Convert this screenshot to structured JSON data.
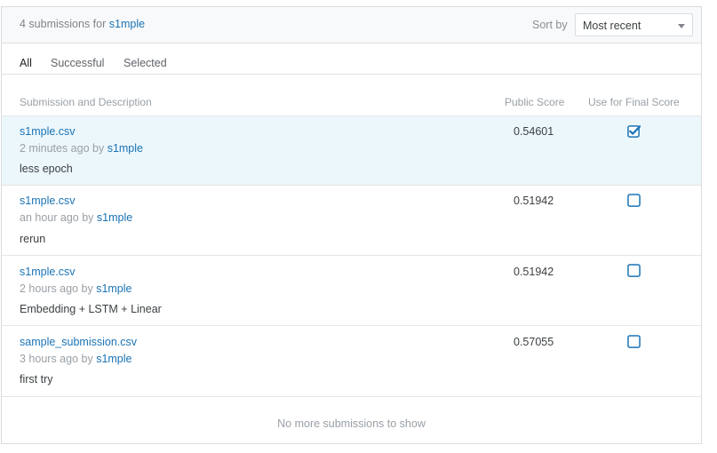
{
  "header": {
    "title_prefix": "4 submissions for",
    "user": "s1mple",
    "sort_label": "Sort by",
    "sort_value": "Most recent"
  },
  "tabs": [
    {
      "label": "All",
      "active": true
    },
    {
      "label": "Successful",
      "active": false
    },
    {
      "label": "Selected",
      "active": false
    }
  ],
  "columns": {
    "submission": "Submission and Description",
    "public_score": "Public Score",
    "final_score": "Use for Final Score"
  },
  "submissions": [
    {
      "file": "s1mple.csv",
      "time": "2 minutes ago by",
      "user": "s1mple",
      "description": "less epoch",
      "score": "0.54601",
      "selected": true
    },
    {
      "file": "s1mple.csv",
      "time": "an hour ago by",
      "user": "s1mple",
      "description": "rerun",
      "score": "0.51942",
      "selected": false
    },
    {
      "file": "s1mple.csv",
      "time": "2 hours ago by",
      "user": "s1mple",
      "description": "Embedding + LSTM + Linear",
      "score": "0.51942",
      "selected": false
    },
    {
      "file": "sample_submission.csv",
      "time": "3 hours ago by",
      "user": "s1mple",
      "description": "first try",
      "score": "0.57055",
      "selected": false
    }
  ],
  "footer": "No more submissions to show",
  "colors": {
    "link": "#1a73b5",
    "check": "#1a73b5",
    "highlight": "#ecf7fc"
  }
}
